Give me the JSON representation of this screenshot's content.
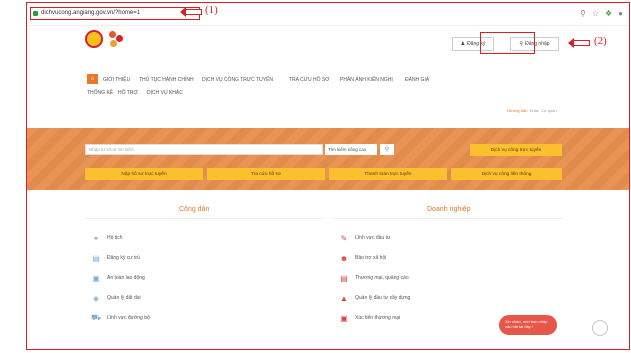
{
  "browser": {
    "url": "dichvucong.angiang.gov.vn/?home=1",
    "icons": [
      "search-icon",
      "star-icon",
      "extension-icon",
      "profile-icon"
    ]
  },
  "annotations": {
    "one": "(1)",
    "two": "(2)"
  },
  "header": {
    "register_label": "Đăng ký",
    "login_label": "Đăng nhập"
  },
  "nav": {
    "home_icon": "home-icon",
    "items": [
      "GIỚI THIỆU",
      "THỦ TỤC HÀNH CHÍNH",
      "DỊCH VỤ CÔNG TRỰC TUYẾN",
      "TRA CỨU HỒ SƠ",
      "PHẢN ÁNH KIẾN NGHỊ",
      "ĐÁNH GIÁ",
      "THỐNG KÊ",
      "HỖ TRỢ",
      "DỊCH VỤ KHÁC"
    ]
  },
  "links": {
    "guide": "Hướng dẫn",
    "other": "Khác",
    "lang": "Cơ quan"
  },
  "search": {
    "placeholder": "Nhập từ khoá tìm kiếm",
    "advanced": "Tìm kiếm nâng cao",
    "online_service": "Dịch vụ công trực tuyến"
  },
  "actions": [
    "Nộp hồ sơ trực tuyến",
    "Tra cứu hồ sơ",
    "Thanh toán trực tuyến",
    "Dịch vụ công liên thông"
  ],
  "citizen": {
    "title": "Công dân",
    "items": [
      "Hộ tịch",
      "Đăng ký cư trú",
      "An toàn lao động",
      "Quản lý đất đai",
      "Lĩnh vực đường bộ"
    ]
  },
  "business": {
    "title": "Doanh nghiệp",
    "items": [
      "Lĩnh vực đầu tư",
      "Bảo trợ xã hội",
      "Thương mại, quảng cáo",
      "Quản lý đầu tư xây dựng",
      "Xúc tiến thương mại"
    ]
  },
  "chat": {
    "text": "Xin chào, mời bạn nhập câu hỏi tại đây !"
  }
}
